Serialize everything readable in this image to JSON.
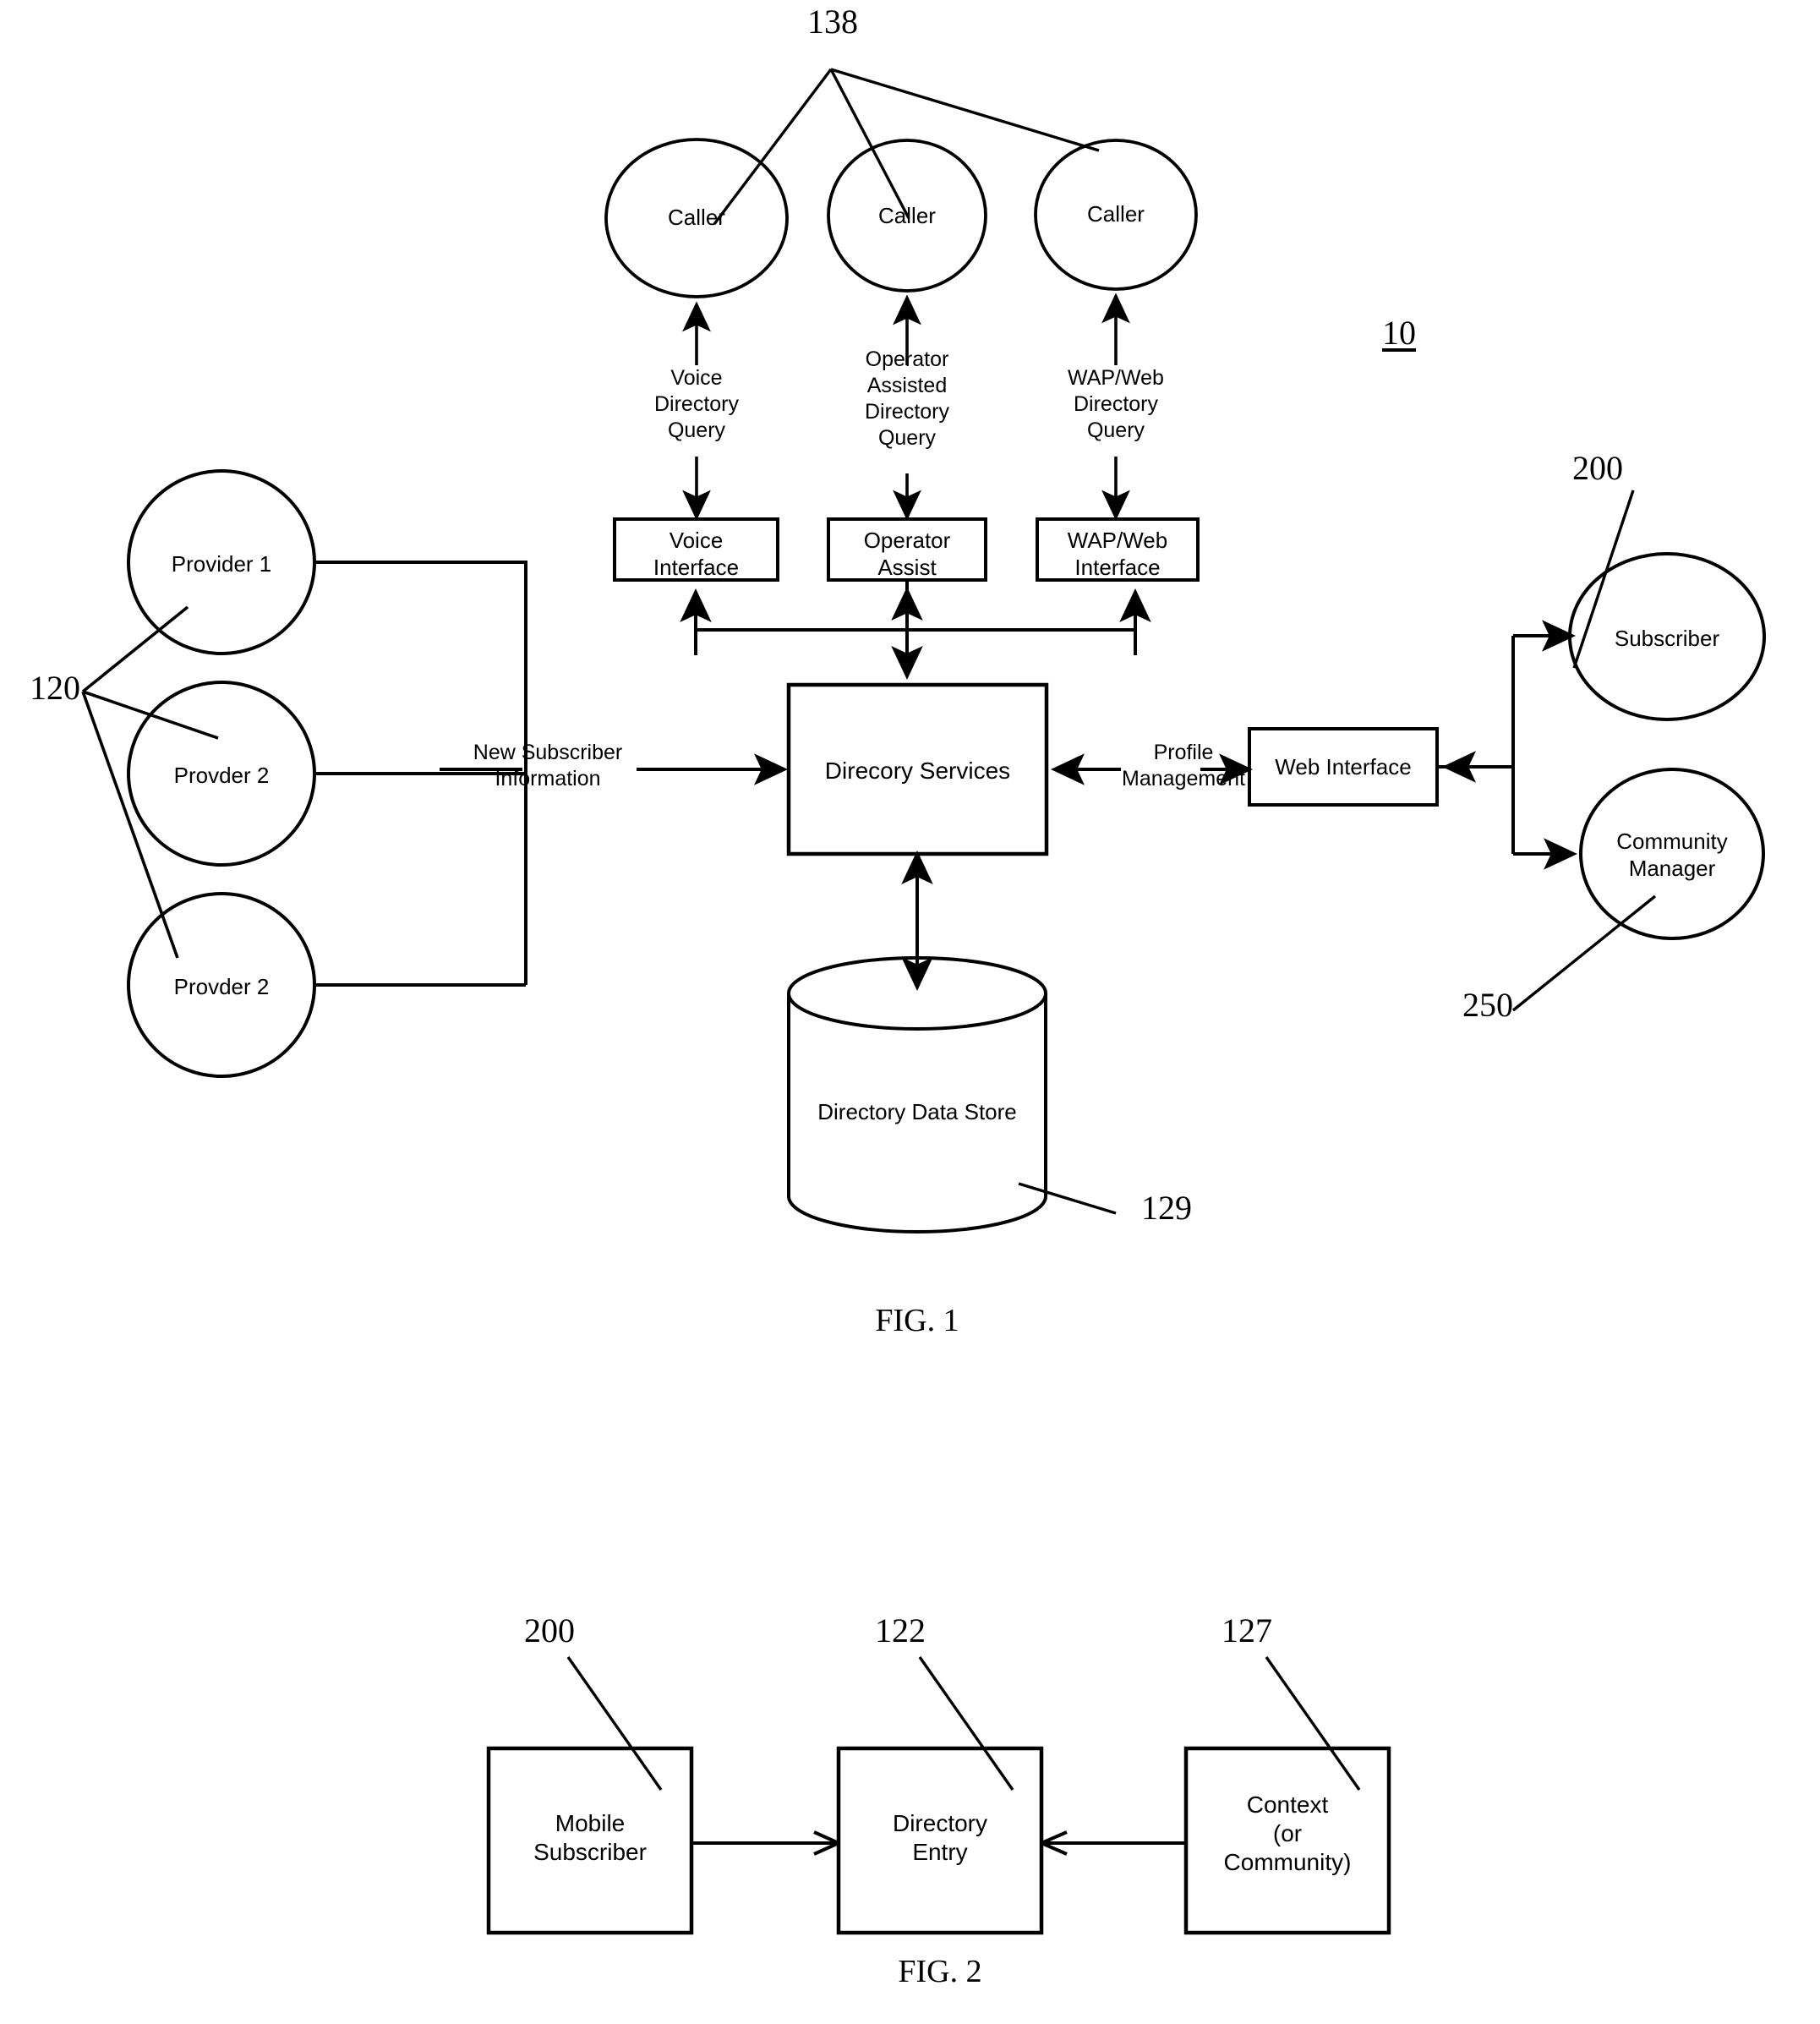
{
  "figure1": {
    "system_ref": "10",
    "callers_ref": "138",
    "providers_ref": "120",
    "datastore_ref": "129",
    "subscriber_ref": "200",
    "community_ref": "250",
    "caption": "FIG. 1",
    "callers": [
      {
        "label": "Caller"
      },
      {
        "label": "Caller"
      },
      {
        "label": "Caller"
      }
    ],
    "providers": [
      {
        "label": "Provider 1"
      },
      {
        "label": "Provder 2"
      },
      {
        "label": "Provder 2"
      }
    ],
    "query_labels": [
      "Voice\nDirectory\nQuery",
      "Operator\nAssisted\nDirectory\nQuery",
      "WAP/Web\nDirectory\nQuery"
    ],
    "interfaces": [
      {
        "label": "Voice\nInterface"
      },
      {
        "label": "Operator\nAssist"
      },
      {
        "label": "WAP/Web\nInterface"
      }
    ],
    "directory_services": "Direcory Services",
    "data_store": "Directory Data Store",
    "new_subscriber_label": "New Subscriber\nInformation",
    "profile_management_label": "Profile\nManagement",
    "web_interface": "Web Interface",
    "subscriber": "Subscriber",
    "community_manager": "Community\nManager"
  },
  "figure2": {
    "caption": "FIG. 2",
    "refs": {
      "mobile_subscriber": "200",
      "directory_entry": "122",
      "context": "127"
    },
    "boxes": [
      {
        "label": "Mobile\nSubscriber"
      },
      {
        "label": "Directory\nEntry"
      },
      {
        "label": "Context\n(or\nCommunity)"
      }
    ]
  },
  "colors": {
    "ink": "#000000",
    "paper": "#ffffff"
  }
}
